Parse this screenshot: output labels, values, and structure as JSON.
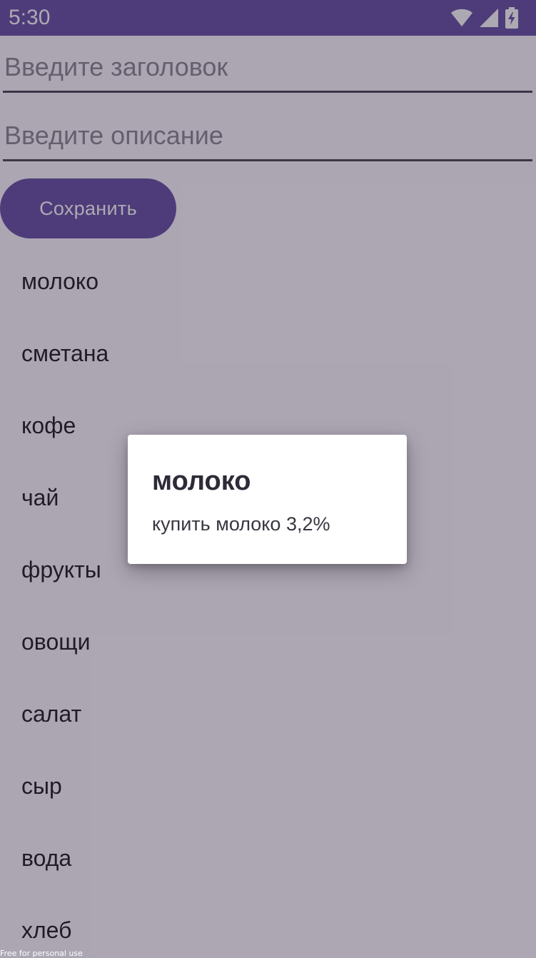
{
  "status_bar": {
    "time": "5:30",
    "icons": [
      "wifi-icon",
      "signal-icon",
      "battery-charging-icon"
    ]
  },
  "form": {
    "title_placeholder": "Введите заголовок",
    "title_value": "",
    "description_placeholder": "Введите описание",
    "description_value": "",
    "save_label": "Сохранить"
  },
  "list": {
    "items": [
      "молоко",
      "сметана",
      "кофе",
      "чай",
      "фрукты",
      "овощи",
      "салат",
      "сыр",
      "вода",
      "хлеб"
    ]
  },
  "dialog": {
    "title": "молоко",
    "message": "купить молоко 3,2%"
  },
  "watermark": "Free for personal use",
  "colors": {
    "primary": "#6750a4",
    "background": "#fefbff",
    "text": "#1c1b1f"
  }
}
